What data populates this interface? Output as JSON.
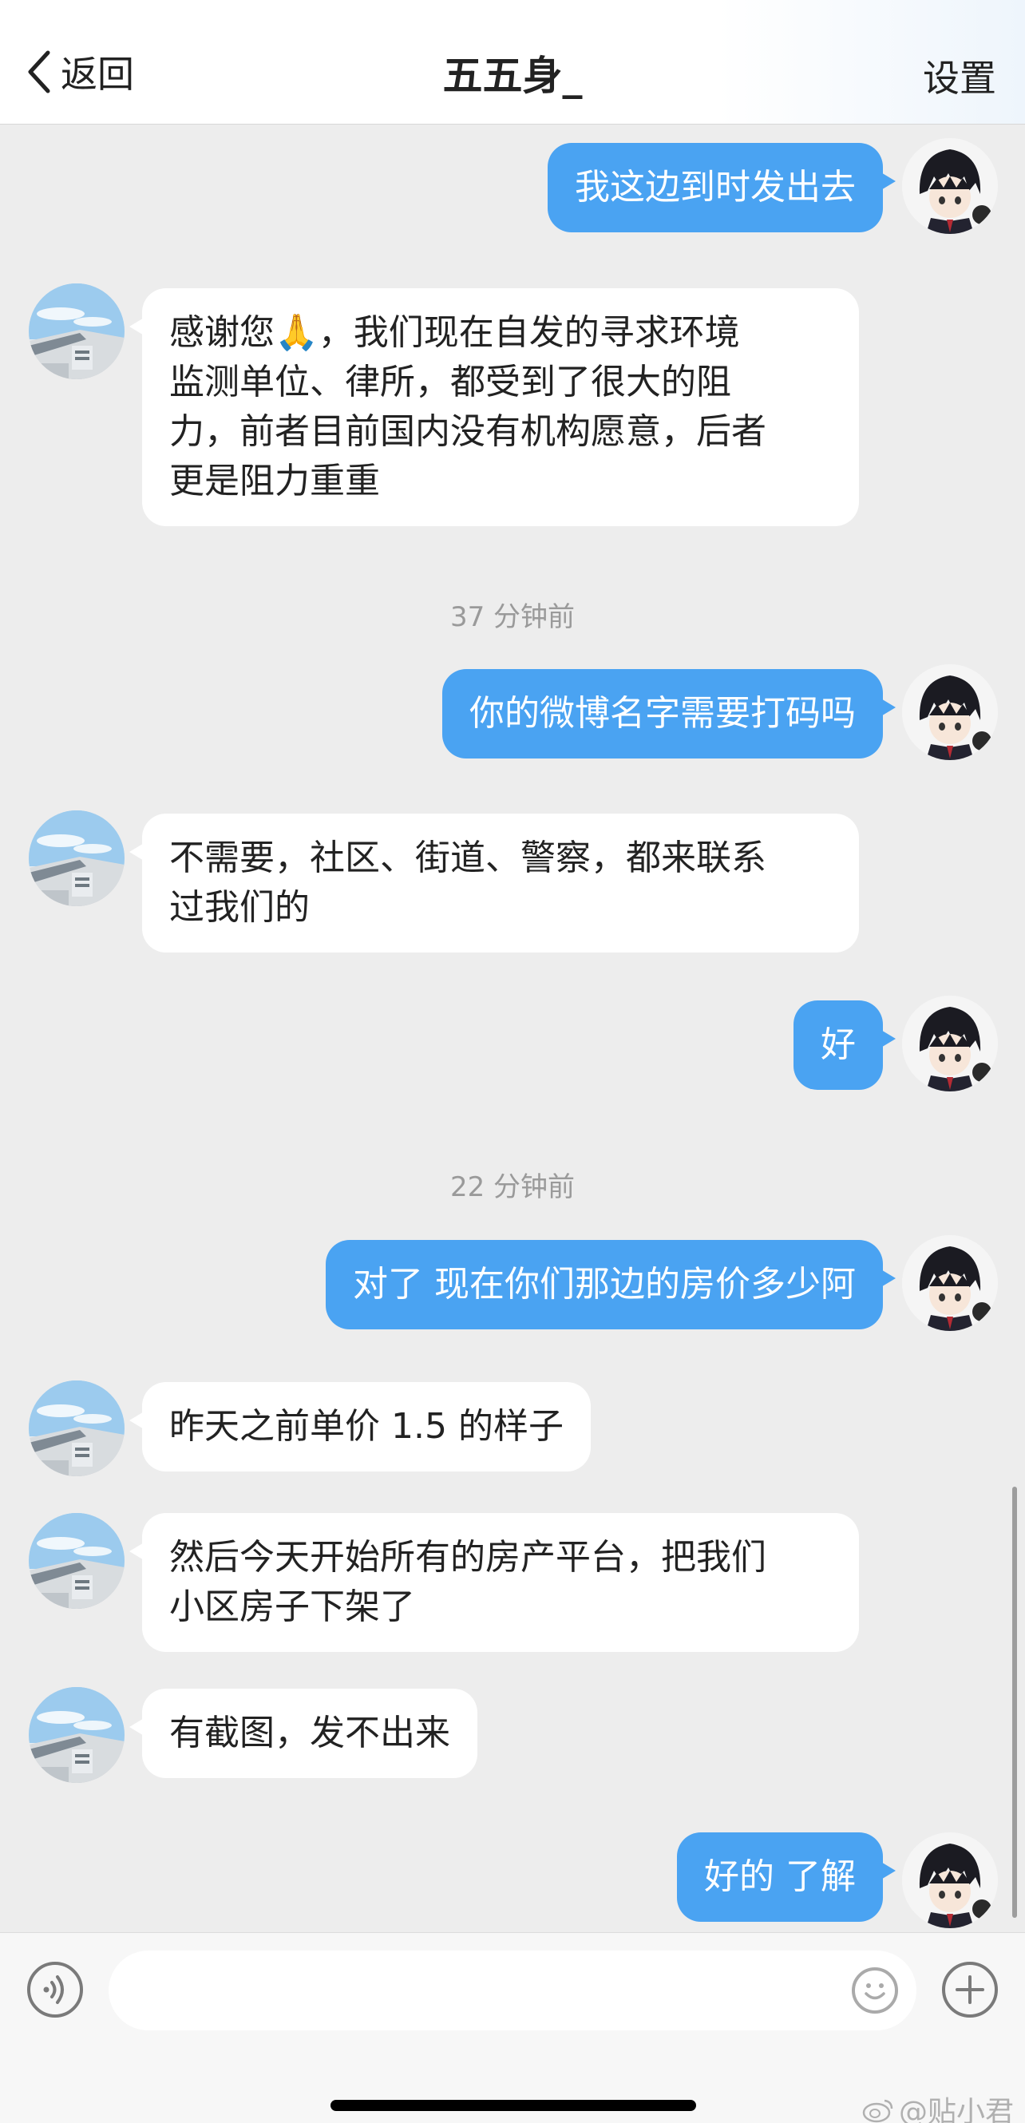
{
  "header": {
    "back_label": "返回",
    "title": "五五身_",
    "settings_label": "设置"
  },
  "messages": [
    {
      "from": "me",
      "text": "我这边到时发出去"
    },
    {
      "from": "them",
      "lines": [
        "感谢您🙏，我们现在自发的寻求环境",
        "监测单位、律所，都受到了很大的阻",
        "力，前者目前国内没有机构愿意，后者",
        "更是阻力重重"
      ]
    },
    {
      "from": "me",
      "text": "你的微博名字需要打码吗"
    },
    {
      "from": "them",
      "lines": [
        "不需要，社区、街道、警察，都来联系",
        "过我们的"
      ]
    },
    {
      "from": "me",
      "text": "好"
    },
    {
      "from": "me",
      "text": "对了 现在你们那边的房价多少阿"
    },
    {
      "from": "them",
      "text": "昨天之前单价 1.5 的样子"
    },
    {
      "from": "them",
      "lines": [
        "然后今天开始所有的房产平台，把我们",
        "小区房子下架了"
      ]
    },
    {
      "from": "them",
      "text": "有截图，发不出来"
    },
    {
      "from": "me",
      "text": "好的 了解"
    }
  ],
  "timestamps": [
    "37 分钟前",
    "22 分钟前"
  ],
  "input": {
    "placeholder": ""
  },
  "watermark": "@贴小君",
  "colors": {
    "my_bubble": "#4aa3f2",
    "their_bubble": "#ffffff",
    "background": "#ededed"
  },
  "icons": {
    "back": "chevron-left-icon",
    "voice": "voice-icon",
    "emoji": "emoji-icon",
    "plus": "plus-icon"
  }
}
